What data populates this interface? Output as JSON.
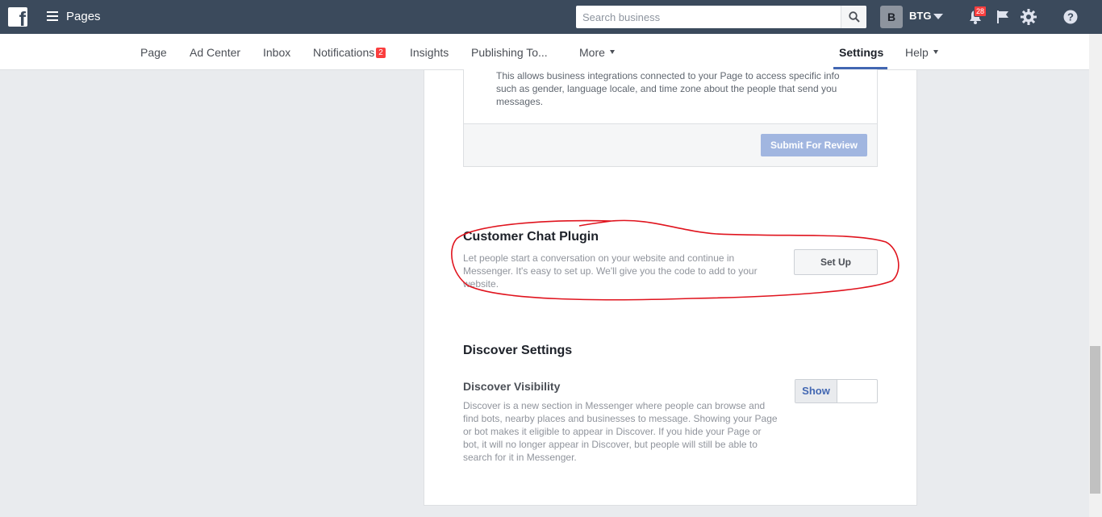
{
  "topbar": {
    "logo": "f",
    "title": "Pages",
    "search": {
      "placeholder": "Search business",
      "value": ""
    },
    "account": {
      "initial": "B",
      "name": "BTG"
    },
    "notifications_count": "28",
    "icons": [
      "menu-icon",
      "search-icon",
      "bell-icon",
      "flag-icon",
      "gear-icon",
      "help-icon"
    ]
  },
  "nav": {
    "items": [
      {
        "label": "Page"
      },
      {
        "label": "Ad Center"
      },
      {
        "label": "Inbox"
      },
      {
        "label": "Notifications",
        "badge": "2"
      },
      {
        "label": "Insights"
      },
      {
        "label": "Publishing To..."
      },
      {
        "label": "More"
      },
      {
        "label": "Settings",
        "active": true
      },
      {
        "label": "Help"
      }
    ]
  },
  "integration": {
    "text": "This allows business integrations connected to your Page to access specific info such as gender, language locale, and time zone about the people that send you messages.",
    "submit_label": "Submit For Review"
  },
  "chat_plugin": {
    "title": "Customer Chat Plugin",
    "description": "Let people start a conversation on your website and continue in Messenger. It's easy to set up. We'll give you the code to add to your website.",
    "button_label": "Set Up"
  },
  "discover": {
    "title": "Discover Settings",
    "visibility_title": "Discover Visibility",
    "visibility_desc": "Discover is a new section in Messenger where people can browse and find bots, nearby places and businesses to message. Showing your Page or bot makes it eligible to appear in Discover. If you hide your Page or bot, it will no longer appear in Discover, but people will still be able to search for it in Messenger.",
    "toggle_show_label": "Show"
  },
  "colors": {
    "topbar": "#3b4a5c",
    "accent": "#4267b2",
    "annotation": "#e0141e",
    "badge": "#fa3e3e"
  }
}
